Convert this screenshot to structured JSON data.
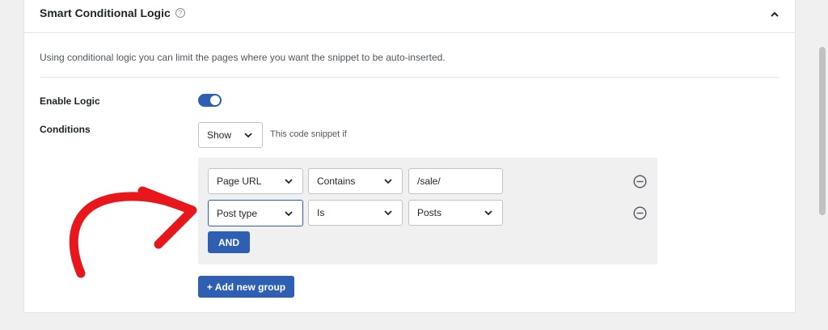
{
  "panel": {
    "title": "Smart Conditional Logic",
    "help_icon_glyph": "?",
    "description": "Using conditional logic you can limit the pages where you want the snippet to be auto-inserted."
  },
  "enable_logic": {
    "label": "Enable Logic",
    "enabled": true
  },
  "conditions": {
    "label": "Conditions",
    "show_select": "Show",
    "hint": "This code snippet if"
  },
  "rules": [
    {
      "field": "Page URL",
      "operator": "Contains",
      "value": "/sale/"
    },
    {
      "field": "Post type",
      "operator": "Is",
      "value": "Posts"
    }
  ],
  "buttons": {
    "and": "AND",
    "add_group": "+ Add new group"
  },
  "colors": {
    "accent": "#2f5fb3",
    "arrow": "#e8171b"
  },
  "icons": {
    "collapse": "chevron-up-icon",
    "select": "chevron-down-icon",
    "remove": "minus-circle-icon",
    "help": "question-circle-icon"
  }
}
